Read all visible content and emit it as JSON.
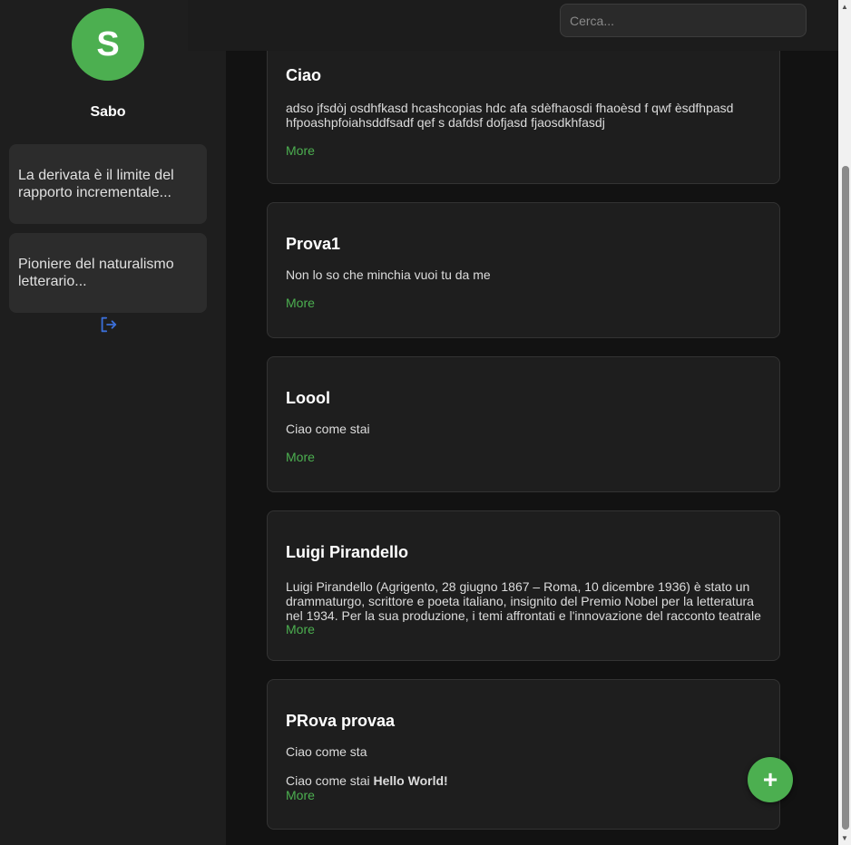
{
  "sidebar": {
    "avatar_letter": "S",
    "username": "Sabo",
    "notes": [
      {
        "label": "La derivata è il limite del rapporto incrementale..."
      },
      {
        "label": "Pioniere del naturalismo letterario..."
      }
    ],
    "logout_icon": "logout-icon"
  },
  "search": {
    "placeholder": "Cerca..."
  },
  "posts": [
    {
      "title": "Ciao",
      "body": "adso jfsdòj osdhfkasd hcashcopias hdc afa sdèfhaosdi fhaoèsd f qwf èsdfhpasd hfpoashpfoiahsddfsadf qef s dafdsf dofjasd fjaosdkhfasdj",
      "more": "More"
    },
    {
      "title": "Prova1",
      "body": "Non lo so che minchia vuoi tu da me",
      "more": "More"
    },
    {
      "title": "Loool",
      "body": "Ciao come stai",
      "more": "More"
    },
    {
      "title": "Luigi Pirandello",
      "body": "Luigi Pirandello (Agrigento, 28 giugno 1867 – Roma, 10 dicembre 1936) è stato un drammaturgo, scrittore e poeta italiano, insignito del Premio Nobel per la letteratura nel 1934. Per la sua produzione, i temi affrontati e l'innovazione del racconto teatrale",
      "more": "More"
    },
    {
      "title": "PRova provaa",
      "body_line1": "Ciao come sta",
      "body_line2_plain": "Ciao come stai ",
      "body_line2_bold": "Hello World!",
      "more": "More"
    }
  ],
  "fab": {
    "label": "+"
  },
  "colors": {
    "accent": "#4caf50",
    "logout": "#3b6fd8"
  }
}
